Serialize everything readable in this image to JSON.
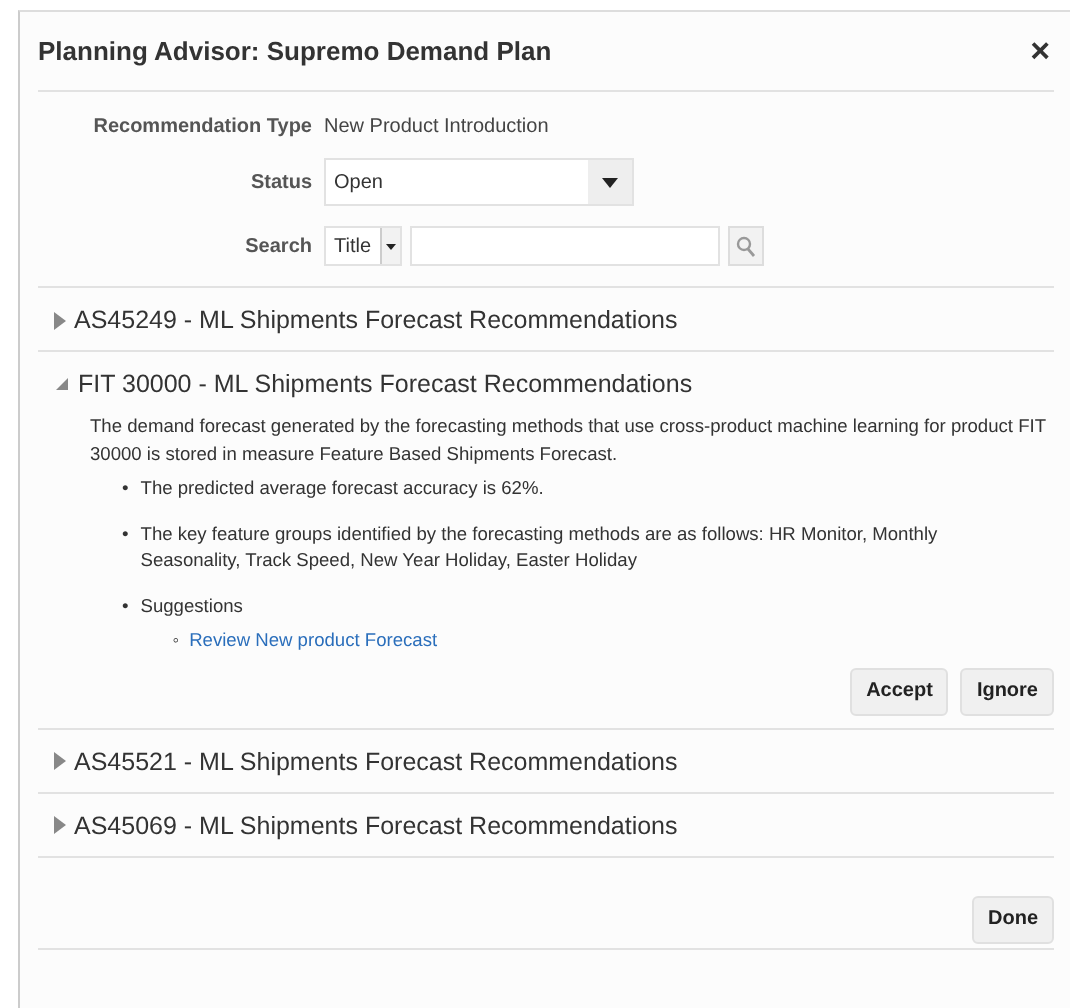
{
  "dialog": {
    "title": "Planning Advisor: Supremo Demand Plan",
    "close": "×"
  },
  "filters": {
    "recommendation_type": {
      "label": "Recommendation Type",
      "value": "New Product Introduction"
    },
    "status": {
      "label": "Status",
      "value": "Open"
    },
    "search": {
      "label": "Search",
      "field": "Title"
    }
  },
  "recommendations": [
    {
      "title": "AS45249 - ML Shipments Forecast Recommendations",
      "expanded": false
    },
    {
      "title": "FIT 30000 - ML Shipments Forecast Recommendations",
      "expanded": true,
      "description": "The demand forecast generated by the forecasting methods that use cross-product machine learning for product FIT 30000 is stored in measure Feature Based Shipments Forecast.",
      "bullets": [
        {
          "marker": "•",
          "text": "The predicted average forecast accuracy is 62%."
        },
        {
          "marker": "•",
          "text": "The key feature groups identified by the forecasting methods are as follows: HR Monitor, Monthly Seasonality, Track Speed, New Year Holiday, Easter Holiday"
        },
        {
          "marker": "•",
          "text": "Suggestions",
          "links": [
            {
              "marker": "◦",
              "text": "Review New product Forecast"
            }
          ]
        }
      ],
      "actions": [
        "Accept",
        "Ignore"
      ]
    },
    {
      "title": "AS45521 - ML Shipments Forecast Recommendations",
      "expanded": false
    },
    {
      "title": "AS45069 - ML Shipments Forecast Recommendations",
      "expanded": false
    }
  ],
  "footer": {
    "buttons": [
      "Done"
    ]
  }
}
